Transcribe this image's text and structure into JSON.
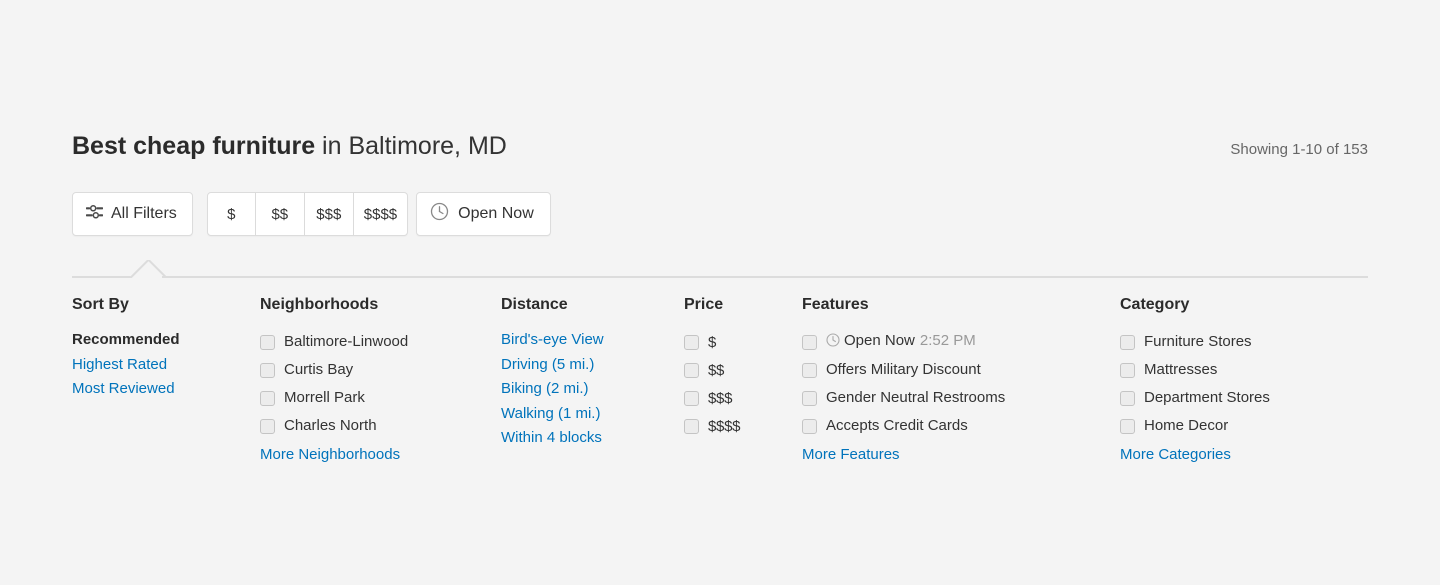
{
  "header": {
    "title_strong": "Best cheap furniture",
    "title_rest": " in Baltimore, MD",
    "showing": "Showing 1-10 of 153"
  },
  "filter_bar": {
    "all_filters_label": "All Filters",
    "all_filters_icon": "sliders-icon",
    "price_buttons": [
      "$",
      "$$",
      "$$$",
      "$$$$"
    ],
    "open_now_label": "Open Now",
    "open_now_icon": "clock-icon"
  },
  "panel": {
    "sort": {
      "title": "Sort By",
      "options": [
        {
          "label": "Recommended",
          "active": true
        },
        {
          "label": "Highest Rated",
          "active": false
        },
        {
          "label": "Most Reviewed",
          "active": false
        }
      ]
    },
    "neighborhoods": {
      "title": "Neighborhoods",
      "options": [
        "Baltimore-Linwood",
        "Curtis Bay",
        "Morrell Park",
        "Charles North"
      ],
      "more_label": "More Neighborhoods"
    },
    "distance": {
      "title": "Distance",
      "options": [
        "Bird's-eye View",
        "Driving (5 mi.)",
        "Biking (2 mi.)",
        "Walking (1 mi.)",
        "Within 4 blocks"
      ]
    },
    "price": {
      "title": "Price",
      "options": [
        "$",
        "$$",
        "$$$",
        "$$$$"
      ]
    },
    "features": {
      "title": "Features",
      "options": [
        {
          "label": "Open Now",
          "time": "2:52 PM",
          "icon": "clock-icon"
        },
        {
          "label": "Offers Military Discount",
          "time": "",
          "icon": ""
        },
        {
          "label": "Gender Neutral Restrooms",
          "time": "",
          "icon": ""
        },
        {
          "label": "Accepts Credit Cards",
          "time": "",
          "icon": ""
        }
      ],
      "more_label": "More Features"
    },
    "category": {
      "title": "Category",
      "options": [
        "Furniture Stores",
        "Mattresses",
        "Department Stores",
        "Home Decor"
      ],
      "more_label": "More Categories"
    }
  },
  "colors": {
    "background": "#f4f4f4",
    "link": "#0073bb",
    "text": "#333333",
    "heading": "#2b2b2b",
    "border": "#dcdcdc",
    "muted": "#999999"
  }
}
